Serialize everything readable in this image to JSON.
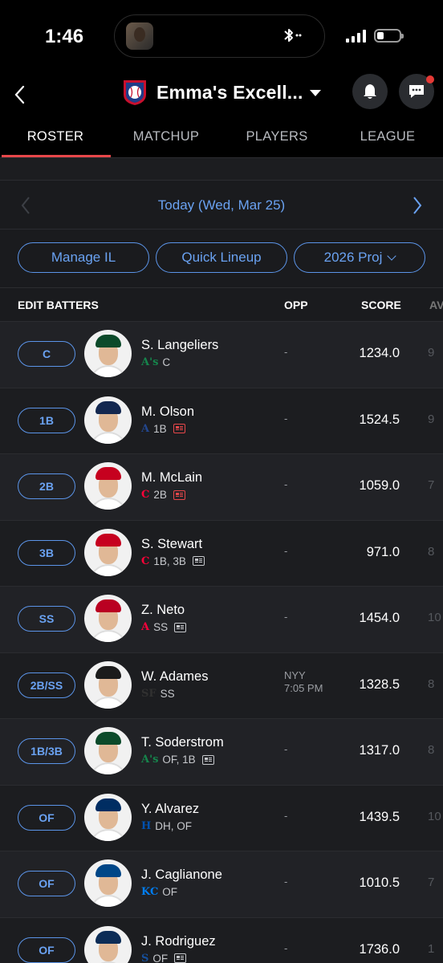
{
  "status": {
    "time": "1:46"
  },
  "header": {
    "team_name": "Emma's Excell..."
  },
  "tabs": [
    {
      "label": "ROSTER"
    },
    {
      "label": "MATCHUP"
    },
    {
      "label": "PLAYERS"
    },
    {
      "label": "LEAGUE"
    }
  ],
  "date": {
    "label": "Today (Wed, Mar 25)"
  },
  "filters": {
    "manage_il": "Manage IL",
    "quick_lineup": "Quick Lineup",
    "projection": "2026 Proj"
  },
  "columns": {
    "edit": "EDIT BATTERS",
    "opp": "OPP",
    "score": "SCORE",
    "avg": "AV"
  },
  "colors": {
    "accent_blue": "#5b94e8",
    "active_tab_red": "#e8474a",
    "bg_dark": "#1a1b1e"
  },
  "players": [
    {
      "slot": "C",
      "name": "S. Langeliers",
      "team_logo": "A's",
      "positions": "C",
      "news": "none",
      "opp_line1": "-",
      "opp_line2": "",
      "score": "1234.0",
      "avg": "9"
    },
    {
      "slot": "1B",
      "name": "M. Olson",
      "team_logo": "A",
      "positions": "1B",
      "news": "red",
      "opp_line1": "-",
      "opp_line2": "",
      "score": "1524.5",
      "avg": "9"
    },
    {
      "slot": "2B",
      "name": "M. McLain",
      "team_logo": "C",
      "positions": "2B",
      "news": "red",
      "opp_line1": "-",
      "opp_line2": "",
      "score": "1059.0",
      "avg": "7"
    },
    {
      "slot": "3B",
      "name": "S. Stewart",
      "team_logo": "C",
      "positions": "1B, 3B",
      "news": "gray",
      "opp_line1": "-",
      "opp_line2": "",
      "score": "971.0",
      "avg": "8"
    },
    {
      "slot": "SS",
      "name": "Z. Neto",
      "team_logo": "A",
      "positions": "SS",
      "news": "gray",
      "opp_line1": "-",
      "opp_line2": "",
      "score": "1454.0",
      "avg": "10"
    },
    {
      "slot": "2B/SS",
      "name": "W. Adames",
      "team_logo": "SF",
      "positions": "SS",
      "news": "none",
      "opp_line1": "NYY",
      "opp_line2": "7:05 PM",
      "score": "1328.5",
      "avg": "8"
    },
    {
      "slot": "1B/3B",
      "name": "T. Soderstrom",
      "team_logo": "A's",
      "positions": "OF, 1B",
      "news": "gray",
      "opp_line1": "-",
      "opp_line2": "",
      "score": "1317.0",
      "avg": "8"
    },
    {
      "slot": "OF",
      "name": "Y. Alvarez",
      "team_logo": "H",
      "positions": "DH, OF",
      "news": "none",
      "opp_line1": "-",
      "opp_line2": "",
      "score": "1439.5",
      "avg": "10"
    },
    {
      "slot": "OF",
      "name": "J. Caglianone",
      "team_logo": "KC",
      "positions": "OF",
      "news": "none",
      "opp_line1": "-",
      "opp_line2": "",
      "score": "1010.5",
      "avg": "7"
    },
    {
      "slot": "OF",
      "name": "J. Rodriguez",
      "team_logo": "S",
      "positions": "OF",
      "news": "gray",
      "opp_line1": "-",
      "opp_line2": "",
      "score": "1736.0",
      "avg": "1"
    }
  ]
}
